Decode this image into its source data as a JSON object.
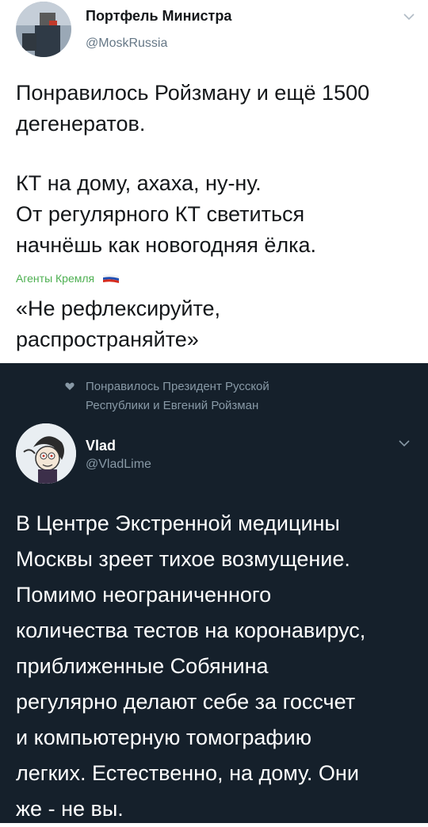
{
  "tweet1": {
    "author_name": "Портфель Министра",
    "author_handle": "@MoskRussia",
    "lines": [
      "Понравилось Ройзману и ещё 1500",
      "дегенератов.",
      "КТ на дому, ахаха, ну-ну.",
      "От регулярного КТ светиться",
      "начнёшь как новогодняя ёлка."
    ],
    "watermark": "Агенты Кремля",
    "footer_lines": [
      "«Не рефлексируйте,",
      "распространяйте»"
    ]
  },
  "tweet2": {
    "liked_lines": [
      "Понравилось Президент Русской",
      "Республики и Евгений Ройзман"
    ],
    "author_name": "Vlad",
    "author_handle": "@VladLime",
    "lines": [
      "В Центре Экстренной медицины",
      "Москвы зреет тихое возмущение.",
      "Помимо неограниченного",
      "количества тестов на коронавирус,",
      "приближенные Собянина",
      "регулярно делают себе за госсчет",
      "и компьютерную томографию",
      "легких. Естественно, на дому. Они",
      "же - не вы."
    ]
  },
  "icons": [
    "avatar-icon",
    "chevron-down-icon",
    "russian-flag-icon",
    "heart-icon"
  ],
  "colors": {
    "light_bg": "#ffffff",
    "dark_bg": "#15202b",
    "green_watermark": "#4caf50",
    "secondary_text": "#8899a6"
  }
}
